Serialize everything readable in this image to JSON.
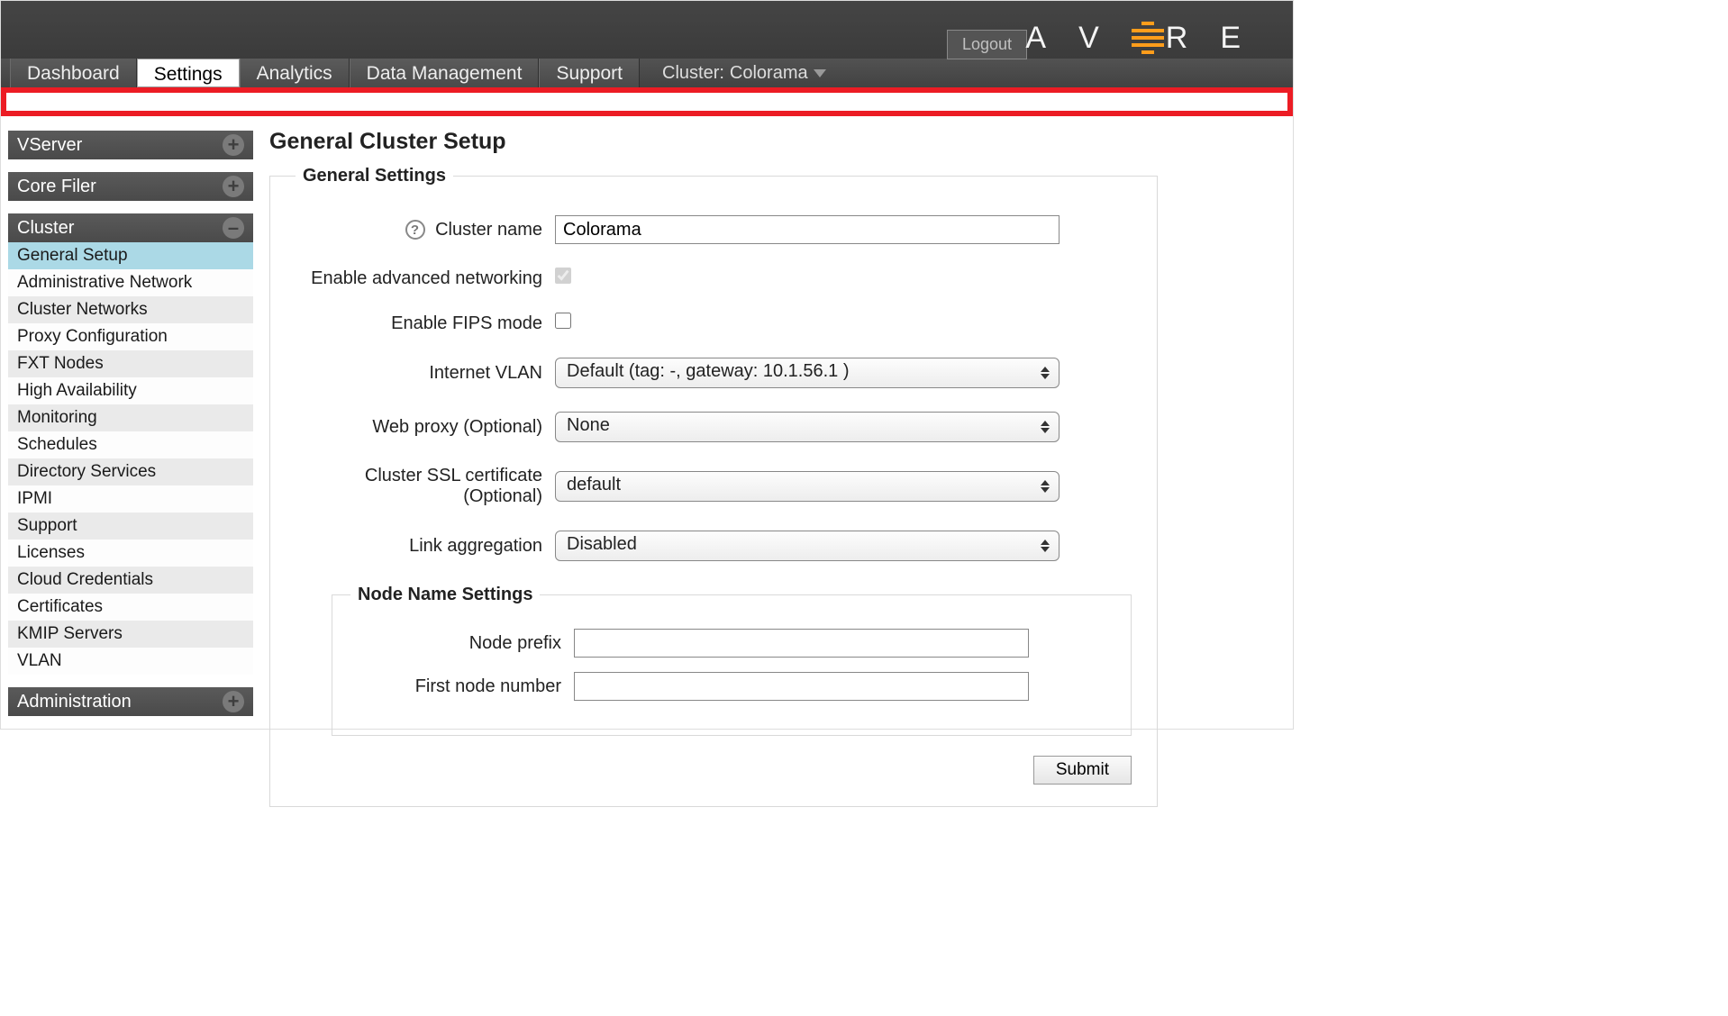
{
  "header": {
    "logout": "Logout",
    "brand_letters": "AV  RE",
    "cluster_label_prefix": "Cluster: ",
    "cluster_name": "Colorama"
  },
  "tabs": {
    "items": [
      {
        "label": "Dashboard"
      },
      {
        "label": "Settings"
      },
      {
        "label": "Analytics"
      },
      {
        "label": "Data Management"
      },
      {
        "label": "Support"
      }
    ],
    "active_index": 1
  },
  "sidebar": {
    "sections": [
      {
        "title": "VServer",
        "expanded": false,
        "items": []
      },
      {
        "title": "Core Filer",
        "expanded": false,
        "items": []
      },
      {
        "title": "Cluster",
        "expanded": true,
        "items": [
          "General Setup",
          "Administrative Network",
          "Cluster Networks",
          "Proxy Configuration",
          "FXT Nodes",
          "High Availability",
          "Monitoring",
          "Schedules",
          "Directory Services",
          "IPMI",
          "Support",
          "Licenses",
          "Cloud Credentials",
          "Certificates",
          "KMIP Servers",
          "VLAN"
        ],
        "selected_index": 0
      },
      {
        "title": "Administration",
        "expanded": false,
        "items": []
      }
    ]
  },
  "main": {
    "page_title": "General Cluster Setup",
    "fieldset_general": "General Settings",
    "fieldset_node": "Node Name Settings",
    "labels": {
      "cluster_name": "Cluster name",
      "enable_adv_net": "Enable advanced networking",
      "enable_fips": "Enable FIPS mode",
      "internet_vlan": "Internet VLAN",
      "web_proxy": "Web proxy (Optional)",
      "ssl_cert_l1": "Cluster SSL certificate",
      "ssl_cert_l2": "(Optional)",
      "link_agg": "Link aggregation",
      "node_prefix": "Node prefix",
      "first_node_number": "First node number"
    },
    "values": {
      "cluster_name": "Colorama",
      "enable_adv_net_checked": true,
      "enable_adv_net_disabled": true,
      "enable_fips_checked": false,
      "internet_vlan": "Default (tag: -, gateway: 10.1.56.1 )",
      "web_proxy": "None",
      "ssl_cert": "default",
      "link_agg": "Disabled",
      "node_prefix": "",
      "first_node_number": ""
    },
    "submit": "Submit"
  }
}
